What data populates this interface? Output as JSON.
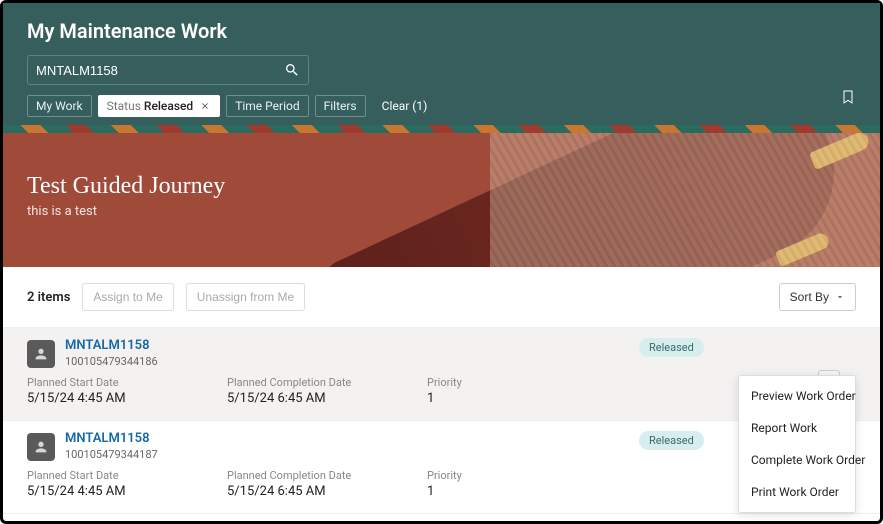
{
  "header": {
    "title": "My Maintenance Work",
    "search_value": "MNTALM1158",
    "filters": {
      "my_work": "My Work",
      "status_label": "Status",
      "status_value": "Released",
      "time_period": "Time Period",
      "filters": "Filters",
      "clear": "Clear (1)"
    }
  },
  "hero": {
    "title": "Test Guided Journey",
    "subtitle": "this is a test"
  },
  "toolbar": {
    "count": "2 items",
    "assign": "Assign to Me",
    "unassign": "Unassign from Me",
    "sort": "Sort By"
  },
  "labels": {
    "planned_start": "Planned Start Date",
    "planned_completion": "Planned Completion Date",
    "priority": "Priority"
  },
  "work_orders": [
    {
      "id": "MNTALM1158",
      "sub": "100105479344186",
      "status": "Released",
      "start": "5/15/24 4:45 AM",
      "completion": "5/15/24 6:45 AM",
      "priority": "1"
    },
    {
      "id": "MNTALM1158",
      "sub": "100105479344187",
      "status": "Released",
      "start": "5/15/24 4:45 AM",
      "completion": "5/15/24 6:45 AM",
      "priority": "1"
    }
  ],
  "menu": {
    "preview": "Preview Work Order",
    "report": "Report Work",
    "complete": "Complete Work Order",
    "print": "Print Work Order"
  }
}
